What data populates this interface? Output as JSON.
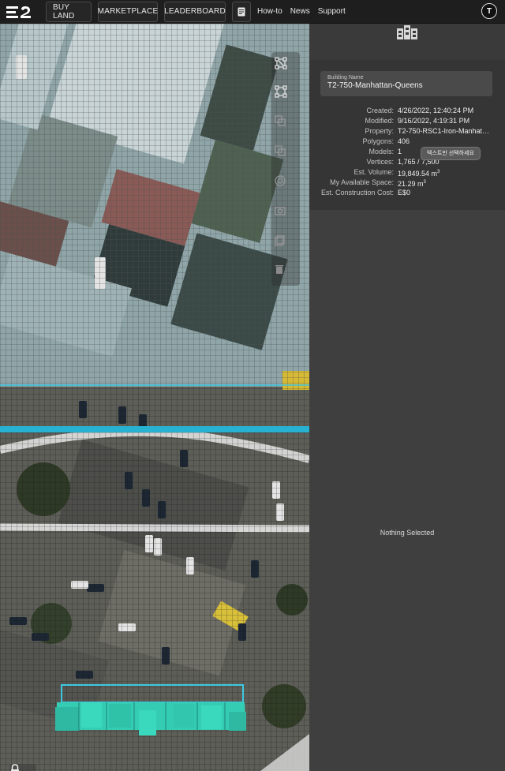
{
  "nav": {
    "logo_text": "E2",
    "buy_land": "BUY LAND",
    "marketplace": "MARKETPLACE",
    "leaderboard": "LEADERBOARD",
    "doc_icon": "document-icon",
    "how_to": "How-to",
    "news": "News",
    "support": "Support",
    "avatar_letter": "T"
  },
  "map": {
    "tools": [
      "node-tool-icon",
      "transform-tool-icon",
      "copy-icon",
      "duplicate-icon",
      "settings-icon",
      "camera-icon",
      "layers-icon",
      "trash-icon"
    ],
    "lock_icon": "lock-icon"
  },
  "panel": {
    "header_icon": "building-icon",
    "building_name_label": "Building Name",
    "building_name": "T2-750-Manhattan-Queens",
    "rows": [
      {
        "key": "Created:",
        "value": "4/26/2022, 12:40:24 PM"
      },
      {
        "key": "Modified:",
        "value": "9/16/2022, 4:19:31 PM"
      },
      {
        "key": "Property:",
        "value": "T2-750-RSC1-Iron-Manhat…"
      },
      {
        "key": "Polygons:",
        "value": "406"
      },
      {
        "key": "Models:",
        "value": "1"
      },
      {
        "key": "Vertices:",
        "value": "1,765 / 7,500"
      },
      {
        "key": "Est. Volume:",
        "value": "19,849.54 m",
        "sup": "3"
      },
      {
        "key": "My Available Space:",
        "value": "21.29 m",
        "sup": "3"
      },
      {
        "key": "Est. Construction Cost:",
        "value": "E$0"
      }
    ],
    "tooltip": "텍스트만 선택하세요",
    "nothing_selected": "Nothing Selected"
  },
  "colors": {
    "accent_cyan": "#2ec4d6",
    "model_teal": "#38d3b8"
  }
}
